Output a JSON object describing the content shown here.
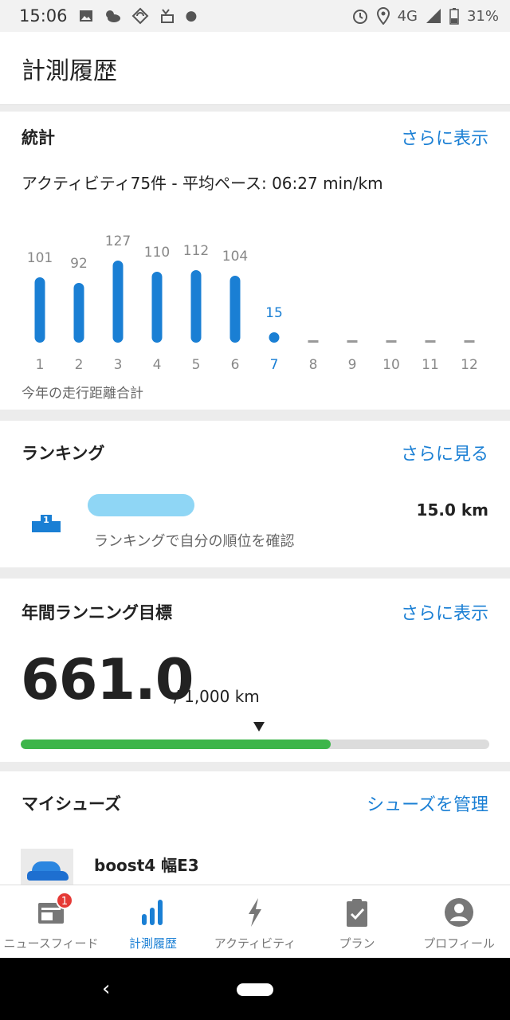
{
  "status_bar": {
    "time": "15:06",
    "network": "4G",
    "battery": "31%"
  },
  "header": {
    "title": "計測履歴"
  },
  "stats": {
    "title": "統計",
    "more_link": "さらに表示",
    "summary": "アクティビティ75件 - 平均ペース: 06:27 min/km",
    "footer": "今年の走行距離合計",
    "chart_data": {
      "type": "bar",
      "categories": [
        "1",
        "2",
        "3",
        "4",
        "5",
        "6",
        "7",
        "8",
        "9",
        "10",
        "11",
        "12"
      ],
      "values": [
        101,
        92,
        127,
        110,
        112,
        104,
        15,
        null,
        null,
        null,
        null,
        null
      ],
      "current_index": 6
    }
  },
  "ranking": {
    "title": "ランキング",
    "more_link": "さらに見る",
    "distance": "15.0 km",
    "subtitle": "ランキングで自分の順位を確認",
    "podium_rank": "1"
  },
  "goal": {
    "title": "年間ランニング目標",
    "more_link": "さらに表示",
    "current": "661.0",
    "target": "/ 1,000 km",
    "progress_fraction": 0.661
  },
  "shoes": {
    "title": "マイシューズ",
    "manage_link": "シューズを管理",
    "items": [
      {
        "name": "boost4 幅E3"
      }
    ]
  },
  "bottom_nav": {
    "items": [
      {
        "label": "ニュースフィード",
        "badge": "1"
      },
      {
        "label": "計測履歴"
      },
      {
        "label": "アクティビティ"
      },
      {
        "label": "プラン"
      },
      {
        "label": "プロフィール"
      }
    ],
    "active_index": 1
  },
  "colors": {
    "accent": "#1a7fd4",
    "progress": "#3db54a",
    "badge": "#e53935"
  }
}
